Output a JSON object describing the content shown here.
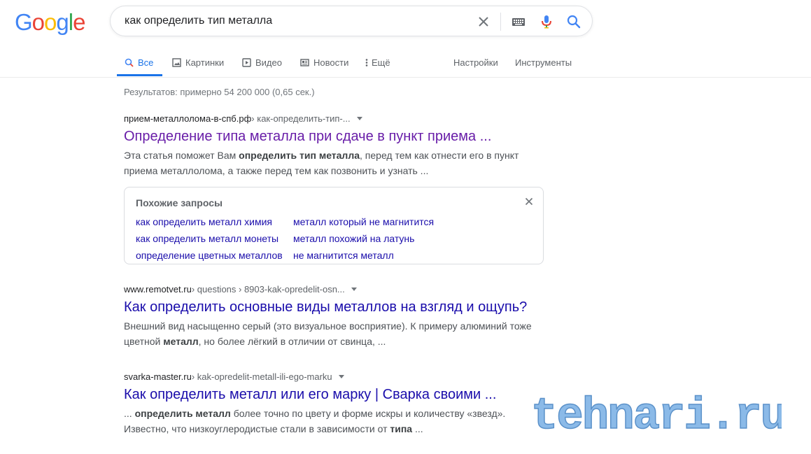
{
  "logo": {
    "letters": [
      "G",
      "o",
      "o",
      "g",
      "l",
      "e"
    ],
    "colors": [
      "#4285f4",
      "#ea4335",
      "#fbbc05",
      "#4285f4",
      "#34a853",
      "#ea4335"
    ]
  },
  "search": {
    "value": "как определить тип металла",
    "placeholder": ""
  },
  "tabs": [
    {
      "label": "Все",
      "icon": "search-icon",
      "active": true
    },
    {
      "label": "Картинки",
      "icon": "image-icon"
    },
    {
      "label": "Видео",
      "icon": "video-icon"
    },
    {
      "label": "Новости",
      "icon": "news-icon"
    },
    {
      "label": "Ещё",
      "icon": "more-vert-icon"
    },
    {
      "label": "Настройки"
    },
    {
      "label": "Инструменты"
    }
  ],
  "stats": "Результатов: примерно 54 200 000 (0,65 сек.)",
  "results": [
    {
      "domain": "прием-металлолома-в-спб.рф",
      "path": " › как-определить-тип-...",
      "title": "Определение типа металла при сдаче в пункт приема ...",
      "snippet": [
        {
          "t": "Эта статья поможет Вам "
        },
        {
          "t": "определить тип металла",
          "b": true
        },
        {
          "t": ", перед тем как отнести его в пункт приема металлолома, а также перед тем как позвонить и узнать ..."
        }
      ]
    },
    {
      "domain": "www.remotvet.ru",
      "path": " › questions › 8903-kak-opredelit-osn...",
      "title": "Как определить основные виды металлов на взгляд и ощупь?",
      "snippet": [
        {
          "t": "Внешний вид насыщенно серый (это визуальное восприятие). К примеру алюминий тоже цветной "
        },
        {
          "t": "металл",
          "b": true
        },
        {
          "t": ", но более лёгкий в отличии от свинца, ..."
        }
      ]
    },
    {
      "domain": "svarka-master.ru",
      "path": " › kak-opredelit-metall-ili-ego-marku",
      "title": "Как определить металл или его марку | Сварка своими ...",
      "snippet": [
        {
          "t": "... "
        },
        {
          "t": "определить металл",
          "b": true
        },
        {
          "t": " более точно по цвету и форме искры и количеству «звезд». Известно, что низкоуглеродистые стали в зависимости от "
        },
        {
          "t": "типа",
          "b": true
        },
        {
          "t": " ..."
        }
      ]
    }
  ],
  "related": {
    "title": "Похожие запросы",
    "col1": [
      "как определить металл химия",
      "как определить металл монеты",
      "определение цветных металлов"
    ],
    "col2": [
      "металл который не магнитится",
      "металл похожий на латунь",
      "не магнитится металл"
    ]
  },
  "watermark": {
    "text": "tehnari.ru"
  },
  "colors": {
    "accent": "#1a73e8",
    "link": "#1a0dab",
    "visited": "#681da8",
    "watermark": "#7fb3e6"
  }
}
